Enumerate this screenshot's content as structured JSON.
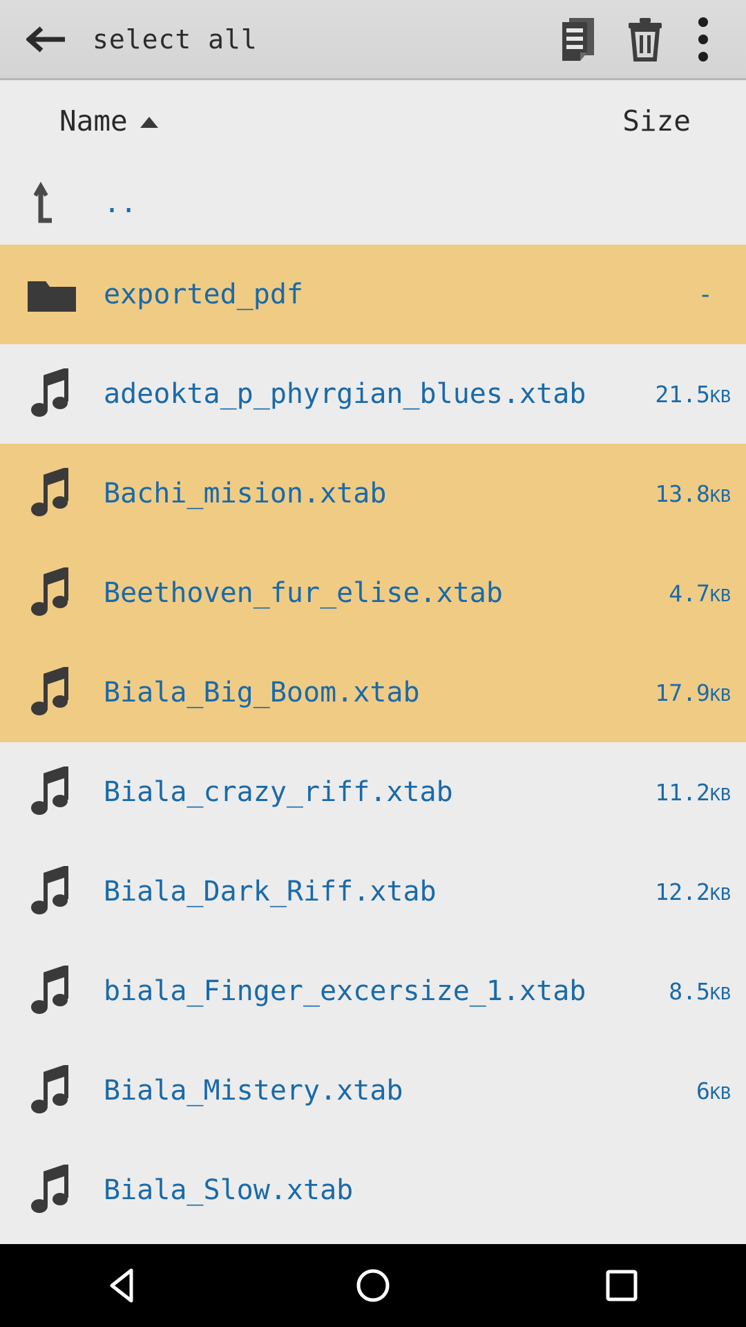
{
  "actionbar": {
    "back_icon": "arrow-left-icon",
    "title": "select all",
    "copy_icon": "copy-documents-icon",
    "delete_icon": "trash-icon",
    "overflow_icon": "overflow-menu-icon"
  },
  "columns": {
    "name_label": "Name",
    "sort_indicator": "ascending",
    "size_label": "Size"
  },
  "colors": {
    "selection": "#F0CB84",
    "link": "#1A6AA8",
    "background": "#ECECEC",
    "actionbar": "#D8D8D8",
    "navbar": "#000000"
  },
  "parent_entry": {
    "icon": "arrow-up-left-icon",
    "name": ".."
  },
  "files": [
    {
      "icon": "folder-icon",
      "name": "exported_pdf",
      "size": "-",
      "unit": "",
      "selected": true
    },
    {
      "icon": "music-note-icon",
      "name": "adeokta_p_phyrgian_blues.xtab",
      "size": "21.5",
      "unit": "KB",
      "selected": false
    },
    {
      "icon": "music-note-icon",
      "name": "Bachi_mision.xtab",
      "size": "13.8",
      "unit": "KB",
      "selected": true
    },
    {
      "icon": "music-note-icon",
      "name": "Beethoven_fur_elise.xtab",
      "size": "4.7",
      "unit": "KB",
      "selected": true
    },
    {
      "icon": "music-note-icon",
      "name": "Biala_Big_Boom.xtab",
      "size": "17.9",
      "unit": "KB",
      "selected": true
    },
    {
      "icon": "music-note-icon",
      "name": "Biala_crazy_riff.xtab",
      "size": "11.2",
      "unit": "KB",
      "selected": false
    },
    {
      "icon": "music-note-icon",
      "name": "Biala_Dark_Riff.xtab",
      "size": "12.2",
      "unit": "KB",
      "selected": false
    },
    {
      "icon": "music-note-icon",
      "name": "biala_Finger_excersize_1.xtab",
      "size": "8.5",
      "unit": "KB",
      "selected": false
    },
    {
      "icon": "music-note-icon",
      "name": "Biala_Mistery.xtab",
      "size": "6",
      "unit": "KB",
      "selected": false
    },
    {
      "icon": "music-note-icon",
      "name": "Biala_Slow.xtab",
      "size": "",
      "unit": "",
      "selected": false
    }
  ],
  "navbar": {
    "back_label": "back-triangle",
    "home_label": "home-circle",
    "recents_label": "recents-square"
  }
}
